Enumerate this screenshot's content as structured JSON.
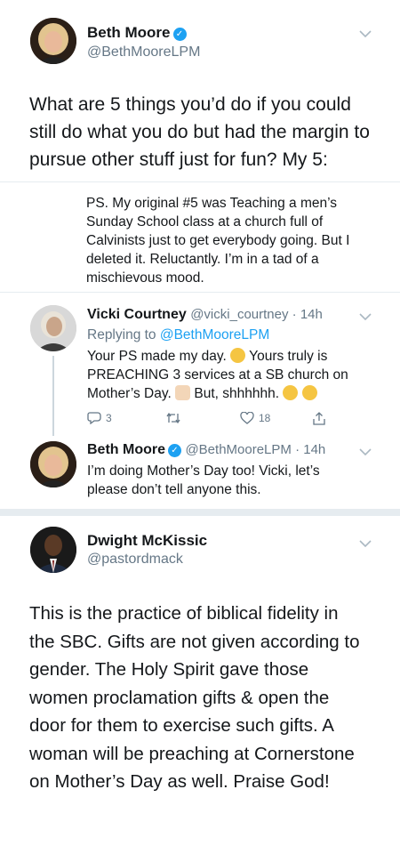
{
  "tweet1": {
    "name": "Beth Moore",
    "handle": "@BethMooreLPM",
    "text": "What are 5 things you’d do if you could still do what you do but had the margin to pursue other stuff just for fun? My 5:"
  },
  "ps_tweet": {
    "text": "PS. My original #5 was Teaching a men’s Sunday School class at a church full of Calvinists just to get everybody going. But I deleted it. Reluctantly. I’m in a tad of a mischievous mood."
  },
  "reply1": {
    "name": "Vicki Courtney",
    "handle": "@vicki_courtney",
    "time": "14h",
    "replying_to_label": "Replying to",
    "replying_to_handle": "@BethMooreLPM",
    "text_part1": "Your PS made my day.",
    "text_part2": "Yours truly is PREACHING 3 services at a SB church on Mother’s Day.",
    "text_part3": "But, shhhhhh.",
    "reply_count": "3",
    "retweet_count": "",
    "like_count": "18"
  },
  "reply2": {
    "name": "Beth Moore",
    "handle": "@BethMooreLPM",
    "time": "14h",
    "text": "I’m doing Mother’s Day too! Vicki, let’s please don’t tell anyone this."
  },
  "tweet2": {
    "name": "Dwight McKissic",
    "handle": "@pastordmack",
    "text": "This is the practice of biblical fidelity in the SBC. Gifts are not given according to gender. The Holy Spirit gave those women proclamation gifts & open the door for them to exercise such gifts. A woman will be preaching at Cornerstone on Mother’s Day as well. Praise God!"
  },
  "icons": {
    "verified": "verified-badge-icon",
    "chevron": "chevron-down-icon",
    "reply": "reply-icon",
    "retweet": "retweet-icon",
    "like": "like-icon",
    "share": "share-icon"
  },
  "colors": {
    "link": "#1da1f2",
    "secondary_text": "#657786",
    "divider": "#e6ecf0"
  }
}
